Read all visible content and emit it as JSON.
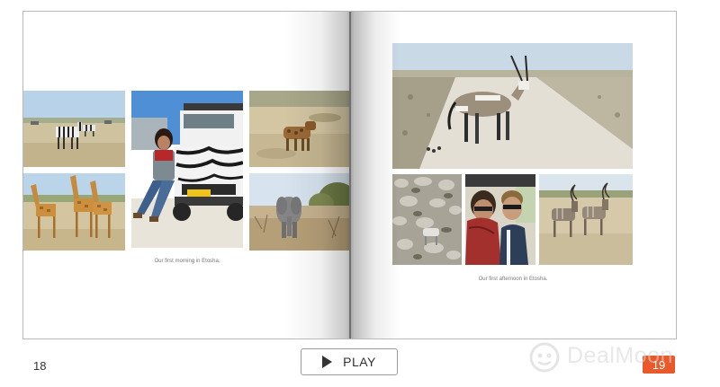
{
  "left_page": {
    "caption": "Our first morning in Etosha.",
    "number": "18"
  },
  "right_page": {
    "caption": "Our first afternoon in Etosha.",
    "number": "19"
  },
  "controls": {
    "play_label": "PLAY",
    "play_icon": "play-icon"
  },
  "watermark": {
    "text": "DealMoon",
    "logo_icon": "dealmoon-logo-icon"
  },
  "photos": {
    "left": [
      "zebras-savanna",
      "woman-with-safari-truck",
      "hyena",
      "giraffes",
      "elephant"
    ],
    "right": [
      "oryx-on-road",
      "rocky-hillside",
      "couple-selfie",
      "kudu-pair"
    ]
  },
  "colors": {
    "badge": "#e85a2a",
    "sky": "#b9d3e9",
    "grass": "#cdbf98",
    "road": "#e6e1d8"
  }
}
